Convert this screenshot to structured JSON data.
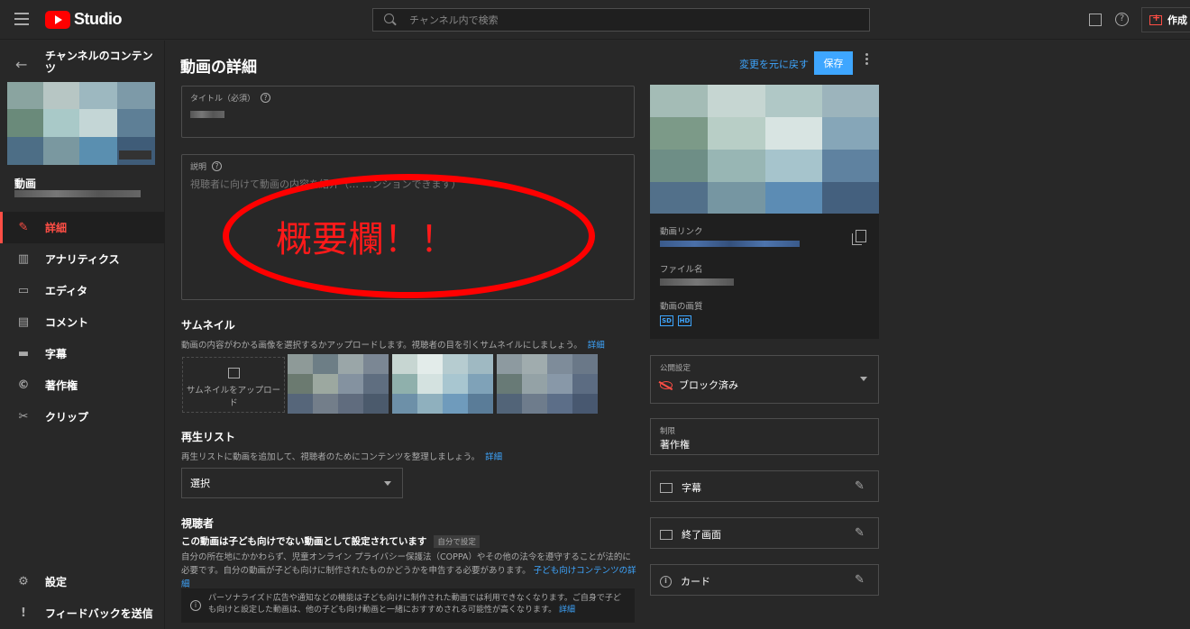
{
  "app": {
    "logo_text": "Studio"
  },
  "search": {
    "placeholder": "チャンネル内で検索"
  },
  "topbar": {
    "help_glyph": "?",
    "create_label": "作成"
  },
  "sidebar": {
    "channel_title": "チャンネルのコンテンツ",
    "video_label": "動画",
    "items": [
      {
        "label": "詳細",
        "icon": "pencil-icon",
        "glyph": "✎",
        "active": true
      },
      {
        "label": "アナリティクス",
        "icon": "analytics-icon",
        "glyph": "▥",
        "active": false
      },
      {
        "label": "エディタ",
        "icon": "editor-icon",
        "glyph": "▭",
        "active": false
      },
      {
        "label": "コメント",
        "icon": "comment-icon",
        "glyph": "▤",
        "active": false
      },
      {
        "label": "字幕",
        "icon": "subtitles-icon",
        "glyph": "▬",
        "active": false
      },
      {
        "label": "著作権",
        "icon": "copyright-icon",
        "glyph": "©",
        "active": false
      },
      {
        "label": "クリップ",
        "icon": "scissors-icon",
        "glyph": "✂",
        "active": false
      }
    ],
    "bottom_items": [
      {
        "label": "設定",
        "icon": "gear-icon",
        "glyph": "⚙"
      },
      {
        "label": "フィードバックを送信",
        "icon": "feedback-icon",
        "glyph": "!"
      }
    ]
  },
  "main": {
    "page_title": "動画の詳細",
    "revert_label": "変更を元に戻す",
    "save_label": "保存",
    "title_field": {
      "label": "タイトル（必須）"
    },
    "description_field": {
      "label": "説明",
      "placeholder": "視聴者に向けて動画の内容を紹介（… …ンションできます）"
    },
    "annotation_text": "概要欄！！",
    "thumbnail": {
      "title": "サムネイル",
      "desc": "動画の内容がわかる画像を選択するかアップロードします。視聴者の目を引くサムネイルにしましょう。",
      "link": "詳細",
      "upload_label": "サムネイルをアップロード"
    },
    "playlist": {
      "title": "再生リスト",
      "desc": "再生リストに動画を追加して、視聴者のためにコンテンツを整理しましょう。",
      "link": "詳細",
      "select_value": "選択"
    },
    "audience": {
      "title": "視聴者",
      "status": "この動画は子ども向けでない動画として設定されています",
      "badge": "自分で設定",
      "desc": "自分の所在地にかかわらず、児童オンライン プライバシー保護法（COPPA）やその他の法令を遵守することが法的に必要です。自分の動画が子ども向けに制作されたものかどうかを申告する必要があります。",
      "desc_link": "子ども向けコンテンツの詳細",
      "info_glyph": "i",
      "info": "パーソナライズド広告や通知などの機能は子ども向けに制作された動画では利用できなくなります。ご自身で子ども向けと設定した動画は、他の子ども向け動画と一緒におすすめされる可能性が高くなります。",
      "info_link": "詳細"
    }
  },
  "right": {
    "video_link_label": "動画リンク",
    "file_name_label": "ファイル名",
    "quality_label": "動画の画質",
    "quality_badges": [
      "SD",
      "HD"
    ],
    "visibility": {
      "label": "公開設定",
      "value": "ブロック済み"
    },
    "restrictions": {
      "label": "制限",
      "value": "著作権"
    },
    "rows": [
      {
        "label": "字幕",
        "icon": "subtitles-icon"
      },
      {
        "label": "終了画面",
        "icon": "end-screen-icon"
      },
      {
        "label": "カード",
        "icon": "info-icon"
      }
    ]
  },
  "colors": {
    "accent": "#3ea6ff",
    "brand": "#ff0000",
    "active": "#ff4e45",
    "annotation": "#ff0000"
  }
}
